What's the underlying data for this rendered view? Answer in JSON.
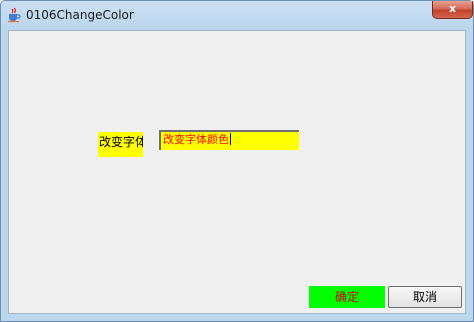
{
  "window": {
    "title": "0106ChangeColor",
    "close_glyph": "x",
    "icon": "java-cup-icon"
  },
  "form": {
    "label_text": "改变字体",
    "input_value": "改变字体颜色",
    "ok_label": "确定",
    "cancel_label": "取消"
  },
  "colors": {
    "label_bg": "#ffff00",
    "input_bg": "#ffff00",
    "input_text": "#ff0000",
    "ok_bg": "#00ff00",
    "ok_text": "#cc0000"
  }
}
